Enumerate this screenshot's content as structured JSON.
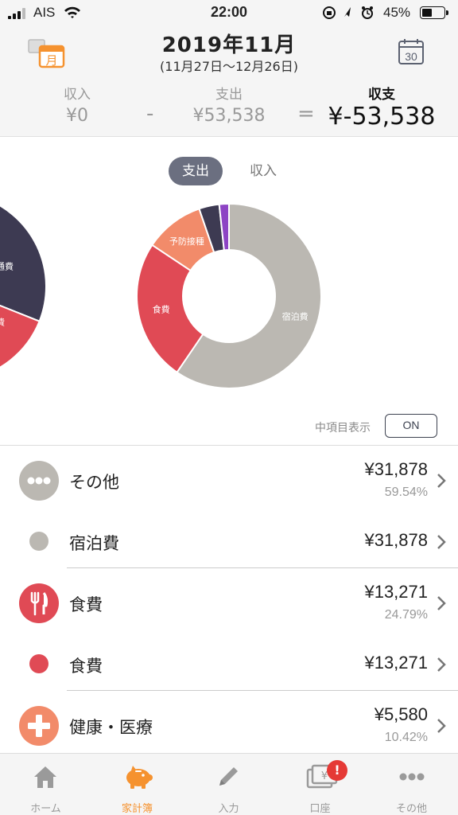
{
  "status_bar": {
    "carrier": "AIS",
    "time": "22:00",
    "battery_percent": "45%",
    "battery_level": 0.45
  },
  "header": {
    "title": "2019年11月",
    "range": "(11月27日～12月26日)",
    "left_icon_glyph": "月",
    "right_icon_glyph": "30",
    "income_label": "収入",
    "income_value": "¥0",
    "minus_sign": "-",
    "expense_label": "支出",
    "expense_value": "¥53,538",
    "equals_sign": "=",
    "balance_label": "収支",
    "balance_value": "¥-53,538"
  },
  "toggle": {
    "expense": "支出",
    "income": "収入",
    "selected": "expense"
  },
  "chart_data": {
    "type": "pie",
    "style": "donut",
    "slices": [
      {
        "label": "宿泊費",
        "value": 31878,
        "color": "#bbb8b2"
      },
      {
        "label": "食費",
        "value": 13271,
        "color": "#e04a55"
      },
      {
        "label": "予防接種",
        "value": 5580,
        "color": "#f28b6a"
      },
      {
        "label": "",
        "value": 1900,
        "color": "#3d3a52"
      },
      {
        "label": "",
        "value": 909,
        "color": "#8d44c4"
      }
    ],
    "side_chart_labels": [
      "通費",
      "食費"
    ]
  },
  "sub_items": {
    "label": "中項目表示",
    "toggle_value": "ON"
  },
  "categories": [
    {
      "name": "その他",
      "amount": "¥31,878",
      "percent": "59.54%",
      "kind": "major",
      "icon": "more-dots-icon",
      "color": "#bbb8b2"
    },
    {
      "name": "宿泊費",
      "amount": "¥31,878",
      "percent": "",
      "kind": "minor",
      "icon": "",
      "color": "#bbb8b2"
    },
    {
      "name": "食費",
      "amount": "¥13,271",
      "percent": "24.79%",
      "kind": "major",
      "icon": "fork-knife-icon",
      "color": "#e04a55"
    },
    {
      "name": "食費",
      "amount": "¥13,271",
      "percent": "",
      "kind": "minor",
      "icon": "",
      "color": "#e04a55"
    },
    {
      "name": "健康・医療",
      "amount": "¥5,580",
      "percent": "10.42%",
      "kind": "major",
      "icon": "medical-cross-icon",
      "color": "#f28b6a"
    }
  ],
  "tabs": [
    {
      "label": "ホーム",
      "icon": "home-icon",
      "active": false
    },
    {
      "label": "家計簿",
      "icon": "piggy-bank-icon",
      "active": true
    },
    {
      "label": "入力",
      "icon": "pencil-icon",
      "active": false
    },
    {
      "label": "口座",
      "icon": "wallet-icon",
      "active": false,
      "badge": "!"
    },
    {
      "label": "その他",
      "icon": "more-dots-icon",
      "active": false
    }
  ],
  "colors": {
    "accent": "#f5922f",
    "toggle_bg": "#6b6f80",
    "badge": "#e53935"
  }
}
